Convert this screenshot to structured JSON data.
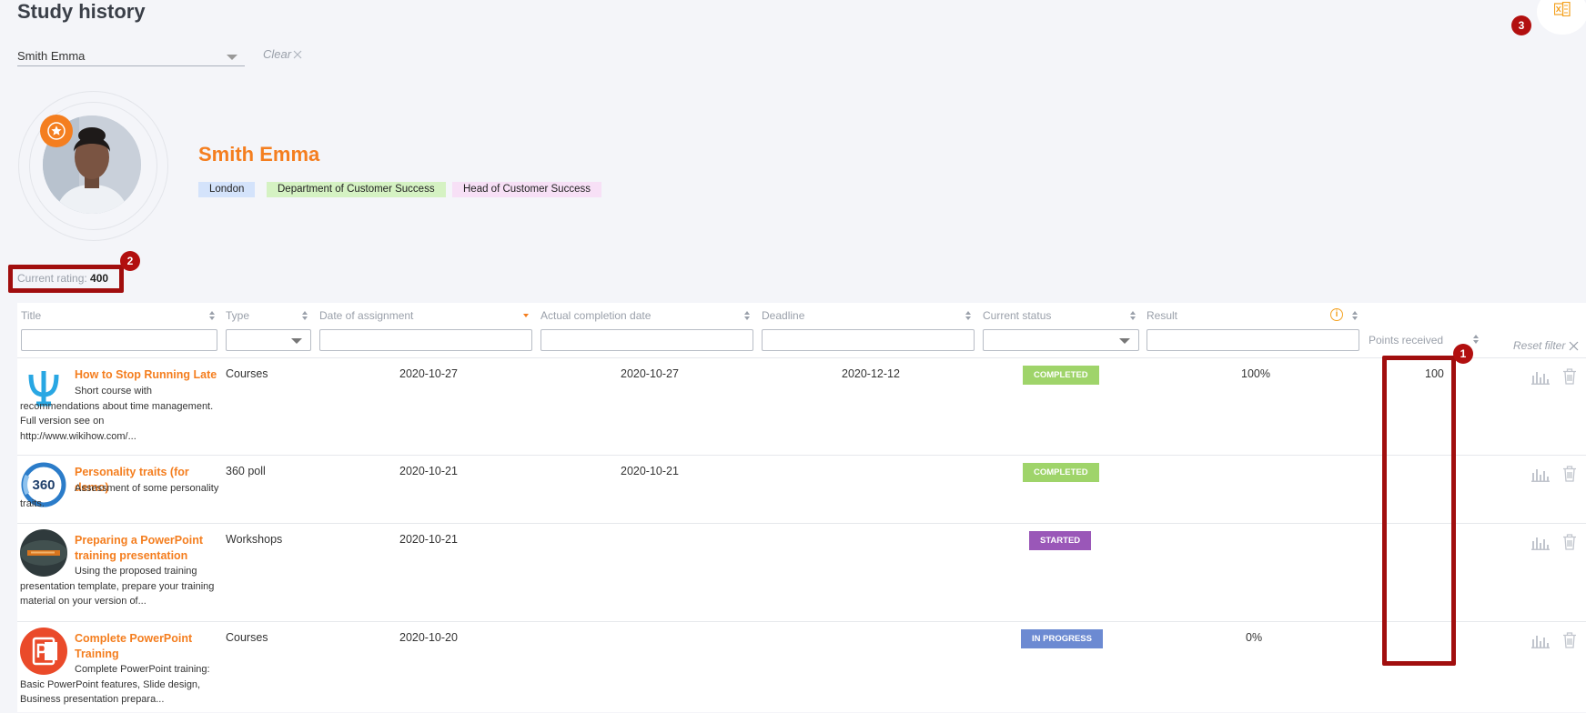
{
  "page": {
    "title": "Study history",
    "selected_user": "Smith Emma",
    "clear_label": "Clear",
    "annotations": [
      "1",
      "2",
      "3"
    ]
  },
  "colors": {
    "accent": "#f47e1f",
    "completed": "#9fd46a",
    "started": "#9a57b8",
    "in_progress": "#6c8ad2",
    "annotation": "#a10e0e"
  },
  "profile": {
    "name": "Smith Emma",
    "tags": [
      "London",
      "Department of Customer Success",
      "Head of Customer Success"
    ],
    "badge_icon": "star-icon"
  },
  "rating": {
    "label": "Current rating:",
    "value": "400"
  },
  "table": {
    "columns": [
      "Title",
      "Type",
      "Date of assignment",
      "Actual completion date",
      "Deadline",
      "Current status",
      "Result",
      "Points received"
    ],
    "reset_filter_label": "Reset filter",
    "rows": [
      {
        "title": "How to Stop Running Late",
        "description": "Short course with recommendations about time management. Full version see on http://www.wikihow.com/...",
        "type": "Courses",
        "assigned": "2020-10-27",
        "completed": "2020-10-27",
        "deadline": "2020-12-12",
        "status": "COMPLETED",
        "result": "100%",
        "points": "100",
        "thumb_icon": "psi-icon"
      },
      {
        "title": "Personality traits (for demo)",
        "description": "Assessment of some personality traits.",
        "type": "360 poll",
        "assigned": "2020-10-21",
        "completed": "2020-10-21",
        "deadline": "",
        "status": "COMPLETED",
        "result": "",
        "points": "",
        "thumb_icon": "feedback-360-icon",
        "thumb_text": "360"
      },
      {
        "title": "Preparing a PowerPoint training presentation",
        "description": "Using the proposed training presentation template, prepare your training material on your version of...",
        "type": "Workshops",
        "assigned": "2020-10-21",
        "completed": "",
        "deadline": "",
        "status": "STARTED",
        "result": "",
        "points": "",
        "thumb_icon": "presentation-photo-icon"
      },
      {
        "title": "Complete PowerPoint Training",
        "description": "Complete PowerPoint training: Basic PowerPoint features, Slide design, Business presentation prepara...",
        "type": "Courses",
        "assigned": "2020-10-20",
        "completed": "",
        "deadline": "",
        "status": "IN PROGRESS",
        "result": "0%",
        "points": "",
        "thumb_icon": "powerpoint-icon"
      }
    ]
  }
}
